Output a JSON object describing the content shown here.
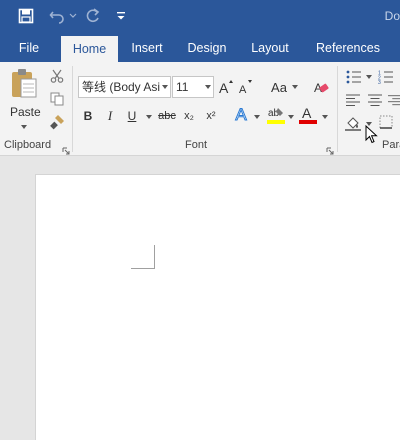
{
  "titlebar": {
    "doc_title": "Do",
    "save_icon": "save-icon",
    "undo_icon": "undo-icon",
    "redo_icon": "redo-icon",
    "customize_icon": "customize-qat-icon",
    "bg_color": "#2b579a"
  },
  "tabs": [
    {
      "label": "File"
    },
    {
      "label": "Home",
      "active": true
    },
    {
      "label": "Insert"
    },
    {
      "label": "Design"
    },
    {
      "label": "Layout"
    },
    {
      "label": "References"
    }
  ],
  "clipboard": {
    "paste_label": "Paste",
    "group_label": "Clipboard"
  },
  "font": {
    "font_name": "等线 (Body Asi",
    "font_size": "11",
    "case_label": "Aa",
    "bold": "B",
    "italic": "I",
    "underline": "U",
    "strikethrough": "abc",
    "subscript": "x₂",
    "superscript": "x²",
    "effects": "A",
    "highlight_color": "#ffff00",
    "font_color": "#e00000",
    "group_label": "Font"
  },
  "paragraph": {
    "group_label": "Para"
  }
}
